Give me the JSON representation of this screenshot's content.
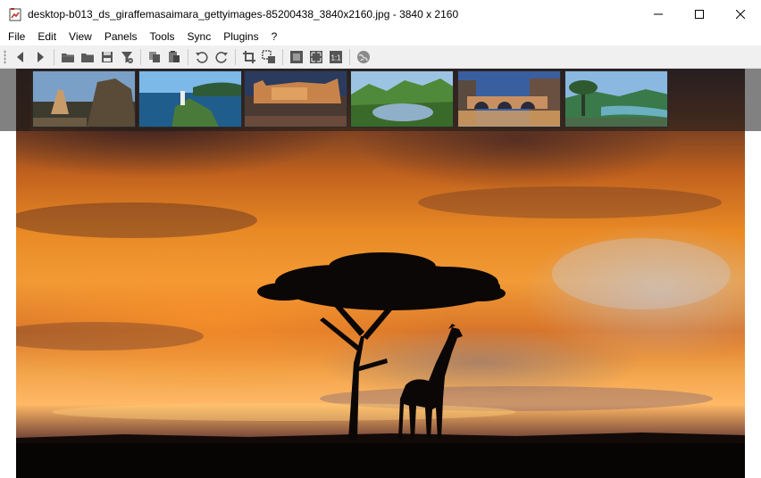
{
  "window": {
    "title": "desktop-b013_ds_giraffemasaimara_gettyimages-85200438_3840x2160.jpg  - 3840 x 2160",
    "controls": [
      "minimize-icon",
      "maximize-icon",
      "close-icon"
    ]
  },
  "menu": {
    "items": [
      "File",
      "Edit",
      "View",
      "Panels",
      "Tools",
      "Sync",
      "Plugins",
      "?"
    ]
  },
  "toolbar": {
    "buttons": [
      {
        "icon": "back-arrow-icon"
      },
      {
        "icon": "forward-arrow-icon"
      },
      {
        "icon": "open-folder-icon"
      },
      {
        "icon": "browse-folder-icon"
      },
      {
        "icon": "save-icon"
      },
      {
        "icon": "filter-icon"
      },
      {
        "icon": "copy-icon"
      },
      {
        "icon": "paste-icon"
      },
      {
        "icon": "rotate-left-icon"
      },
      {
        "icon": "rotate-right-icon"
      },
      {
        "icon": "crop-icon"
      },
      {
        "icon": "resize-icon"
      },
      {
        "icon": "fit-window-icon"
      },
      {
        "icon": "fullscreen-icon"
      },
      {
        "icon": "actual-size-icon",
        "label": "1:1"
      },
      {
        "icon": "globe-icon"
      }
    ]
  },
  "filmstrip": {
    "thumbnails": [
      {
        "subject": "coastal rock formations",
        "colors": [
          "#6c8fb3",
          "#c79b6a",
          "#3d3a2e"
        ]
      },
      {
        "subject": "lighthouse on coast",
        "colors": [
          "#5aa0d8",
          "#1f5e8c",
          "#e9e6dc"
        ]
      },
      {
        "subject": "illuminated castle",
        "colors": [
          "#2a3b5e",
          "#c8834a",
          "#6a4a3a"
        ]
      },
      {
        "subject": "green valley lake",
        "colors": [
          "#8fb8d8",
          "#4f8a3a",
          "#2f4a2a"
        ]
      },
      {
        "subject": "bridge with arches",
        "colors": [
          "#3a5fa0",
          "#d9a060",
          "#5a4a40"
        ]
      },
      {
        "subject": "river gorge with tree",
        "colors": [
          "#8ab8e0",
          "#3a7a4a",
          "#6ab0c0"
        ]
      }
    ]
  },
  "image": {
    "subject": "acacia-tree-and-giraffe-silhouette-at-sunset"
  },
  "colors": {
    "toolbar_bg": "#f0f0f0",
    "filmstrip_overlay": "#191919",
    "sunset_orange": "#e98a25"
  }
}
